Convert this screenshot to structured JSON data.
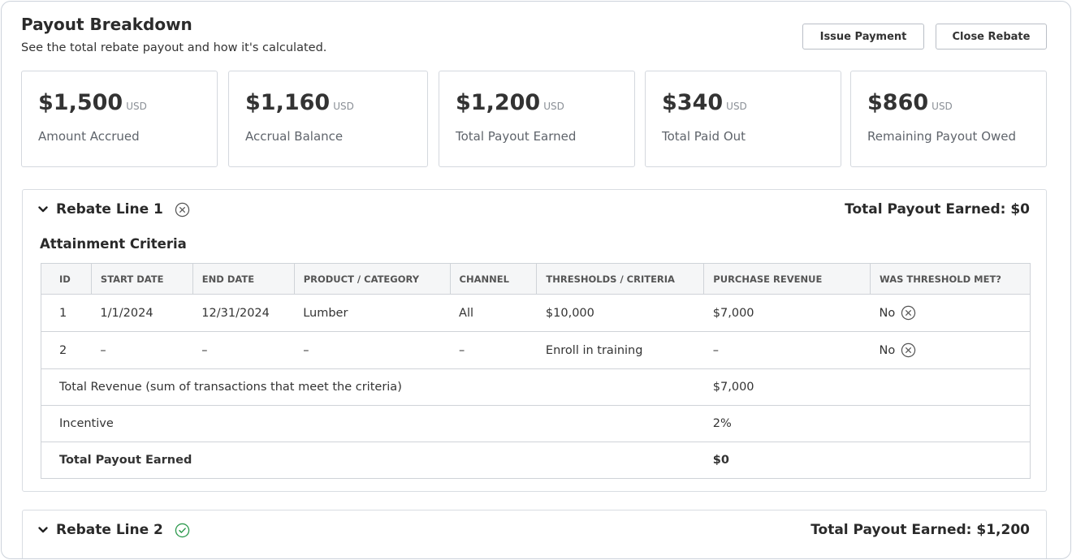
{
  "header": {
    "title": "Payout Breakdown",
    "subtitle": "See the total rebate payout and how it's calculated.",
    "issue_payment_label": "Issue Payment",
    "close_rebate_label": "Close Rebate"
  },
  "cards": [
    {
      "amount": "$1,500",
      "currency": "USD",
      "label": "Amount Accrued"
    },
    {
      "amount": "$1,160",
      "currency": "USD",
      "label": "Accrual Balance"
    },
    {
      "amount": "$1,200",
      "currency": "USD",
      "label": "Total Payout Earned"
    },
    {
      "amount": "$340",
      "currency": "USD",
      "label": "Total Paid Out"
    },
    {
      "amount": "$860",
      "currency": "USD",
      "label": "Remaining Payout Owed"
    }
  ],
  "rebate_lines": [
    {
      "title": "Rebate Line 1",
      "status_icon": "x-circle-icon",
      "total": "Total Payout Earned: $0",
      "section_title": "Attainment Criteria",
      "columns": [
        "ID",
        "START DATE",
        "END DATE",
        "PRODUCT / CATEGORY",
        "CHANNEL",
        "THRESHOLDS / CRITERIA",
        "PURCHASE REVENUE",
        "WAS THRESHOLD MET?"
      ],
      "rows": [
        {
          "id": "1",
          "start": "1/1/2024",
          "end": "12/31/2024",
          "product": "Lumber",
          "channel": "All",
          "threshold": "$10,000",
          "revenue": "$7,000",
          "met": "No"
        },
        {
          "id": "2",
          "start": "–",
          "end": "–",
          "product": "–",
          "channel": "–",
          "threshold": "Enroll in training",
          "revenue": "–",
          "met": "No"
        }
      ],
      "summary": [
        {
          "label": "Total Revenue (sum of transactions that meet the criteria)",
          "value": "$7,000"
        },
        {
          "label": "Incentive",
          "value": "2%"
        },
        {
          "label": "Total Payout Earned",
          "value": "$0"
        }
      ]
    },
    {
      "title": "Rebate Line 2",
      "status_icon": "check-circle-icon",
      "total": "Total Payout Earned: $1,200"
    }
  ],
  "colors": {
    "fail_icon": "#555555",
    "success_icon": "#2e9a4e",
    "border": "#d4d8de"
  }
}
